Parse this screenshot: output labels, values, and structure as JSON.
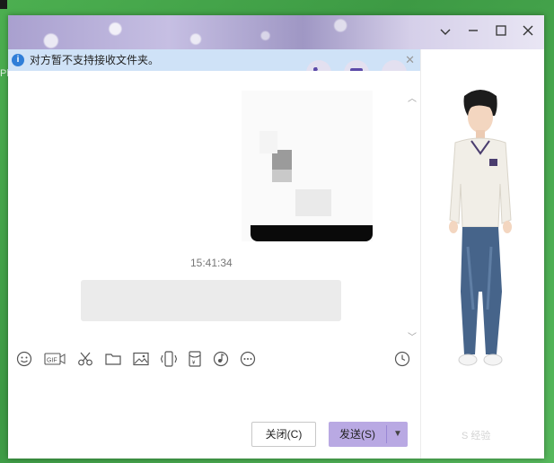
{
  "infobar": {
    "text": "对方暂不支持接收文件夹。"
  },
  "chat": {
    "timestamp": "15:41:34"
  },
  "buttons": {
    "close_label": "关闭(C)",
    "send_label": "发送(S)"
  },
  "icons": {
    "titlebar": [
      "chevron-down-icon",
      "minimize-icon",
      "maximize-icon",
      "close-icon"
    ],
    "top_actions": [
      "phone-icon",
      "video-icon",
      "more-icon"
    ],
    "toolbar": [
      "emoji-icon",
      "gif-icon",
      "scissors-icon",
      "folder-icon",
      "image-icon",
      "shake-icon",
      "red-packet-icon",
      "music-icon",
      "more-icon",
      "history-clock-icon"
    ]
  },
  "colors": {
    "accent": "#b9a9e3",
    "info_bg": "#cfe2f7",
    "info_icon": "#2f7ed8",
    "send_arrow_divider": "#9a88d4"
  }
}
